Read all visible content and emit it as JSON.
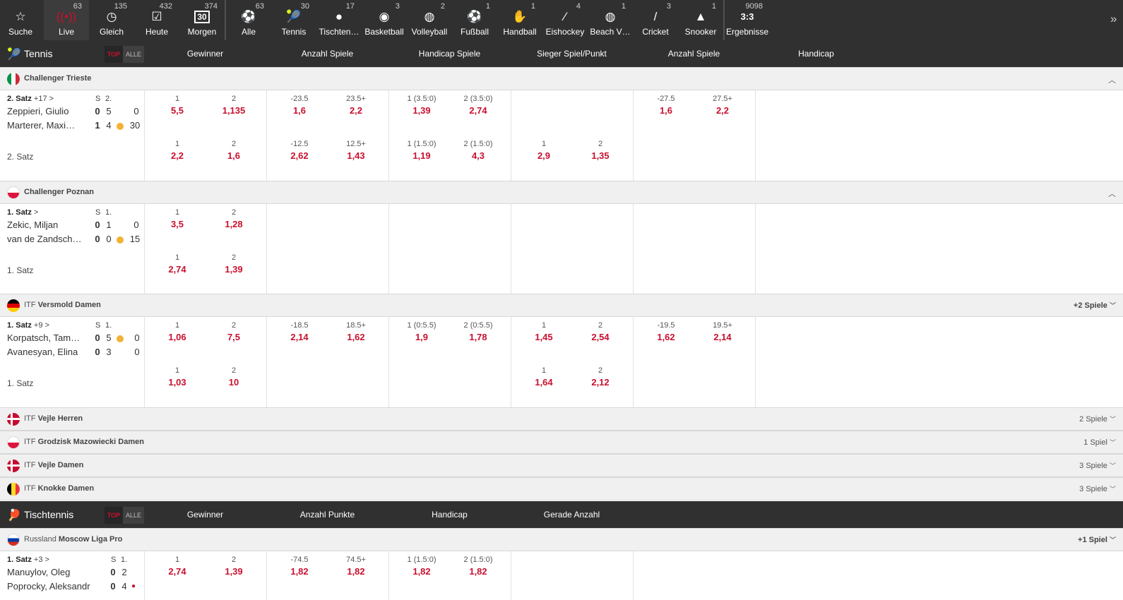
{
  "nav": [
    {
      "label": "Suche",
      "icon": "search-star-icon",
      "count": ""
    },
    {
      "label": "Live",
      "icon": "live-broadcast-icon",
      "count": "63"
    },
    {
      "label": "Gleich",
      "icon": "clock-icon",
      "count": "135"
    },
    {
      "label": "Heute",
      "icon": "calendar-check-icon",
      "count": "432"
    },
    {
      "label": "Morgen",
      "icon": "calendar-30-icon",
      "count": "374"
    },
    {
      "label": "Alle",
      "icon": "all-sports-icon",
      "count": "63"
    },
    {
      "label": "Tennis",
      "icon": "tennis-icon",
      "count": "30"
    },
    {
      "label": "Tischten…",
      "icon": "table-tennis-icon",
      "count": "17"
    },
    {
      "label": "Basketball",
      "icon": "basketball-icon",
      "count": "3"
    },
    {
      "label": "Volleyball",
      "icon": "volleyball-icon",
      "count": "2"
    },
    {
      "label": "Fußball",
      "icon": "football-icon",
      "count": "1"
    },
    {
      "label": "Handball",
      "icon": "handball-icon",
      "count": "1"
    },
    {
      "label": "Eishockey",
      "icon": "ice-hockey-icon",
      "count": "4"
    },
    {
      "label": "Beach V…",
      "icon": "beach-volleyball-icon",
      "count": "1"
    },
    {
      "label": "Cricket",
      "icon": "cricket-icon",
      "count": "3"
    },
    {
      "label": "Snooker",
      "icon": "snooker-icon",
      "count": "1"
    },
    {
      "label": "Ergebnisse",
      "icon": "results-icon",
      "count": "9098",
      "icon_text": "3:3"
    }
  ],
  "colors": {
    "accent": "#c8102e",
    "dark": "#303030",
    "ball": "#f2b233"
  },
  "tennis": {
    "title": "Tennis",
    "top": "TOP",
    "alle": "ALLE",
    "cols": [
      "Gewinner",
      "Anzahl Spiele",
      "Handicap Spiele",
      "Sieger Spiel/Punkt",
      "Anzahl Spiele",
      "Handicap"
    ],
    "leagues": [
      {
        "name": "Challenger Trieste",
        "prefix": "",
        "right": "",
        "flag": "it"
      },
      {
        "name": "Challenger Poznan",
        "prefix": "",
        "right": "",
        "flag": "pl"
      },
      {
        "name": "Versmold Damen",
        "prefix": "ITF",
        "right": "+2 Spiele",
        "flag": "de"
      },
      {
        "name": "Vejle Herren",
        "prefix": "ITF",
        "right": "2 Spiele",
        "flag": "dk"
      },
      {
        "name": "Grodzisk Mazowiecki Damen",
        "prefix": "ITF",
        "right": "1 Spiel",
        "flag": "pl"
      },
      {
        "name": "Vejle Damen",
        "prefix": "ITF",
        "right": "3 Spiele",
        "flag": "dk"
      },
      {
        "name": "Knokke Damen",
        "prefix": "ITF",
        "right": "3 Spiele",
        "flag": "be"
      }
    ],
    "matches": [
      {
        "status": "2. Satz",
        "extra": "+17 >",
        "s": "S",
        "setno": "2.",
        "p1": "Zeppieri, Giulio",
        "p2": "Marterer, Maxi…",
        "s1": "0",
        "s2": "1",
        "g1": "5",
        "g2": "4",
        "pt1": "0",
        "pt2": "30",
        "foot": "2. Satz",
        "odds": [
          {
            "h": "1",
            "v": "5,5"
          },
          {
            "h": "2",
            "v": "1,135"
          },
          {
            "h": "-23.5",
            "v": "1,6"
          },
          {
            "h": "23.5+",
            "v": "2,2"
          },
          {
            "h": "1 (3.5:0)",
            "v": "1,39"
          },
          {
            "h": "2 (3.5:0)",
            "v": "2,74"
          },
          {
            "h": "-27.5",
            "v": "1,6"
          },
          {
            "h": "27.5+",
            "v": "2,2"
          },
          {
            "h": "1",
            "v": "2,2"
          },
          {
            "h": "2",
            "v": "1,6"
          },
          {
            "h": "-12.5",
            "v": "2,62"
          },
          {
            "h": "12.5+",
            "v": "1,43"
          },
          {
            "h": "1 (1.5:0)",
            "v": "1,19"
          },
          {
            "h": "2 (1.5:0)",
            "v": "4,3"
          },
          {
            "h": "1",
            "v": "2,9"
          },
          {
            "h": "2",
            "v": "1,35"
          }
        ]
      },
      {
        "status": "1. Satz",
        "extra": ">",
        "s": "S",
        "setno": "1.",
        "p1": "Zekic, Miljan",
        "p2": "van de Zandsch…",
        "s1": "0",
        "s2": "0",
        "g1": "1",
        "g2": "0",
        "pt1": "0",
        "pt2": "15",
        "foot": "1. Satz",
        "odds": [
          {
            "h": "1",
            "v": "3,5"
          },
          {
            "h": "2",
            "v": "1,28"
          },
          {
            "h": "1",
            "v": "2,74"
          },
          {
            "h": "2",
            "v": "1,39"
          }
        ]
      },
      {
        "status": "1. Satz",
        "extra": "+9 >",
        "s": "S",
        "setno": "1.",
        "p1": "Korpatsch, Tam…",
        "p2": "Avanesyan, Elina",
        "s1": "0",
        "s2": "0",
        "g1": "5",
        "g2": "3",
        "pt1": "0",
        "pt2": "0",
        "foot": "1. Satz",
        "odds": [
          {
            "h": "1",
            "v": "1,06"
          },
          {
            "h": "2",
            "v": "7,5"
          },
          {
            "h": "-18.5",
            "v": "2,14"
          },
          {
            "h": "18.5+",
            "v": "1,62"
          },
          {
            "h": "1 (0:5.5)",
            "v": "1,9"
          },
          {
            "h": "2 (0:5.5)",
            "v": "1,78"
          },
          {
            "h": "1",
            "v": "1,45"
          },
          {
            "h": "2",
            "v": "2,54"
          },
          {
            "h": "-19.5",
            "v": "1,62"
          },
          {
            "h": "19.5+",
            "v": "2,14"
          },
          {
            "h": "1",
            "v": "1,03"
          },
          {
            "h": "2",
            "v": "10"
          },
          {
            "h": "1",
            "v": "1,64"
          },
          {
            "h": "2",
            "v": "2,12"
          }
        ]
      }
    ]
  },
  "tt": {
    "title": "Tischtennis",
    "top": "TOP",
    "alle": "ALLE",
    "cols": [
      "Gewinner",
      "Anzahl Punkte",
      "Handicap",
      "Gerade Anzahl"
    ],
    "league": {
      "prefix": "Russland",
      "name": "Moscow Liga Pro",
      "right": "+1 Spiel",
      "flag": "ru"
    },
    "match": {
      "status": "1. Satz",
      "extra": "+3 >",
      "s": "S",
      "setno": "1.",
      "p1": "Manuylov, Oleg",
      "p2": "Poprocky, Aleksandr",
      "s1": "0",
      "s2": "0",
      "g1": "2",
      "g2": "4",
      "odds": [
        {
          "h": "1",
          "v": "2,74"
        },
        {
          "h": "2",
          "v": "1,39"
        },
        {
          "h": "-74.5",
          "v": "1,82"
        },
        {
          "h": "74.5+",
          "v": "1,82"
        },
        {
          "h": "1 (1.5:0)",
          "v": "1,82"
        },
        {
          "h": "2 (1.5:0)",
          "v": "1,82"
        }
      ]
    }
  }
}
